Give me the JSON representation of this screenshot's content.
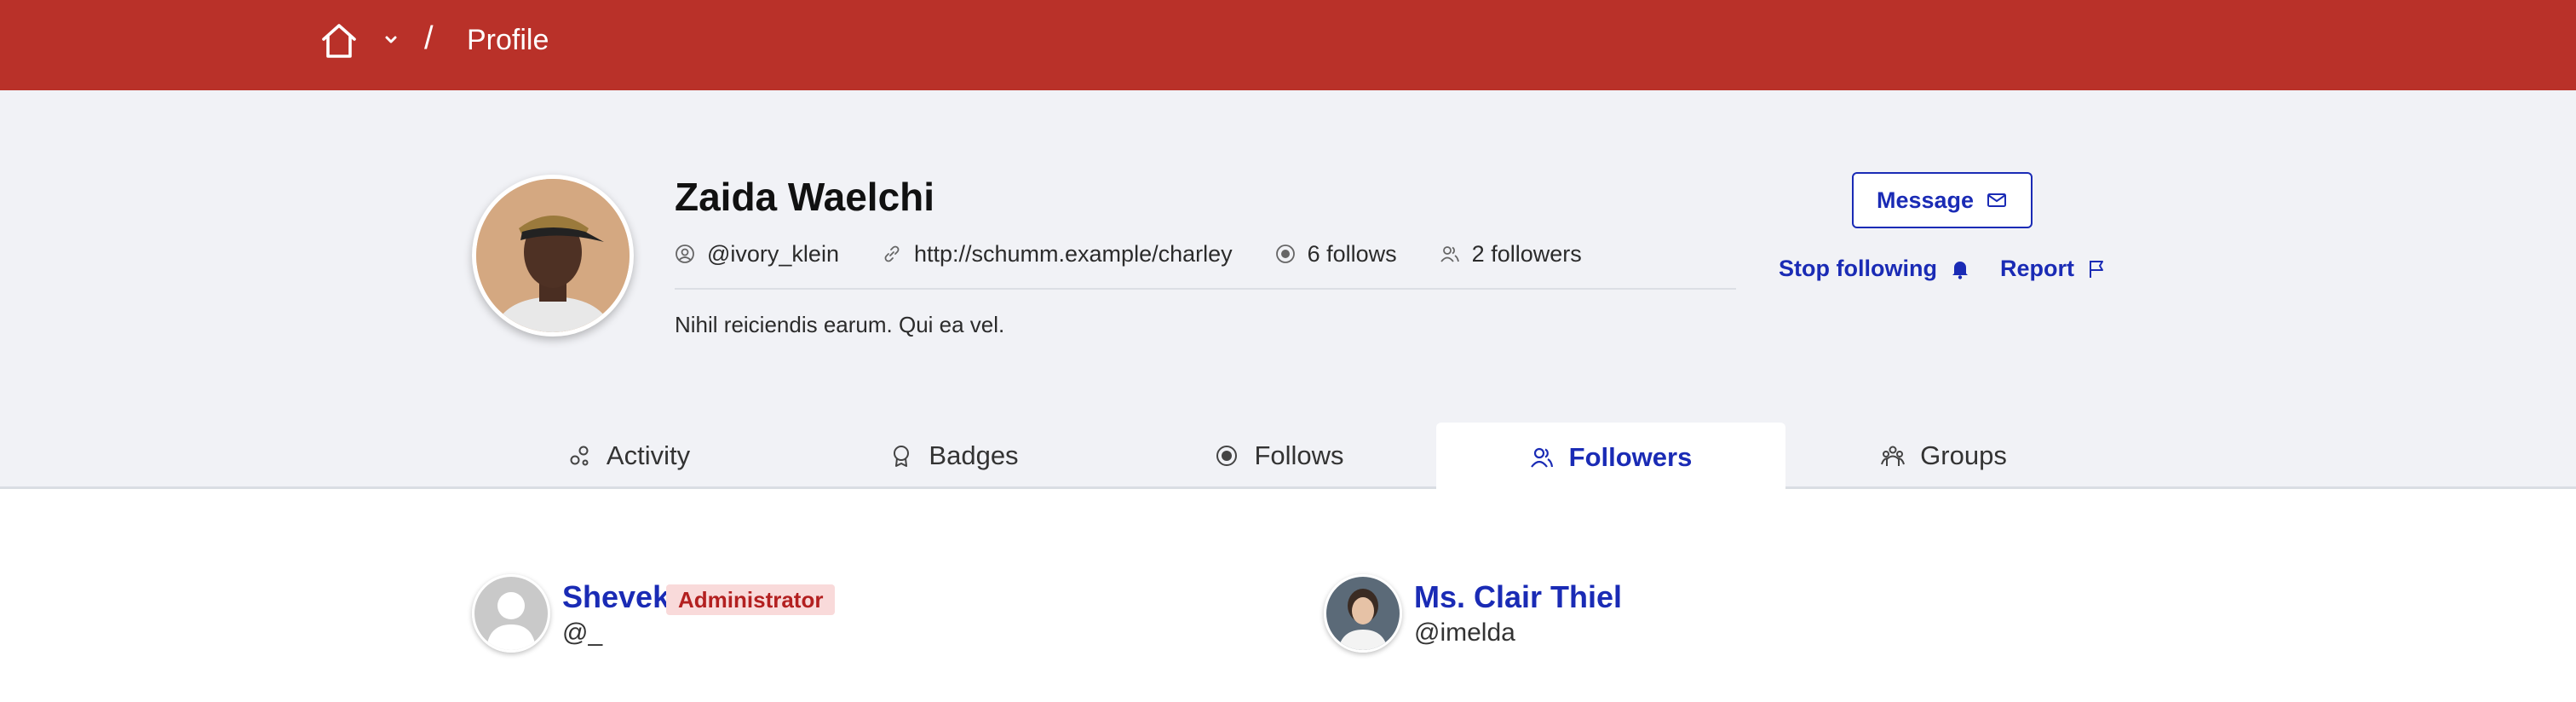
{
  "header": {
    "breadcrumb_separator": "/",
    "current_page": "Profile",
    "bar_color": "#b93129",
    "icons": {
      "home": "home-icon",
      "dropdown": "chevron-down-icon"
    }
  },
  "profile": {
    "name": "Zaida Waelchi",
    "username": "@ivory_klein",
    "website": "http://schumm.example/charley",
    "follows": "6 follows",
    "followers": "2 followers",
    "bio": "Nihil reiciendis earum. Qui ea vel."
  },
  "actions": {
    "message": "Message",
    "stop_following": "Stop following",
    "report": "Report",
    "accent_color": "#1a2bb5"
  },
  "tabs": [
    {
      "label": "Activity",
      "icon": "activity-icon",
      "active": false
    },
    {
      "label": "Badges",
      "icon": "badge-icon",
      "active": false
    },
    {
      "label": "Follows",
      "icon": "follows-icon",
      "active": false
    },
    {
      "label": "Followers",
      "icon": "followers-icon",
      "active": true
    },
    {
      "label": "Groups",
      "icon": "groups-icon",
      "active": false
    }
  ],
  "followers": [
    {
      "name": "Shevek",
      "handle": "@_",
      "badge": "Administrator"
    },
    {
      "name": "Ms. Clair Thiel",
      "handle": "@imelda"
    }
  ]
}
